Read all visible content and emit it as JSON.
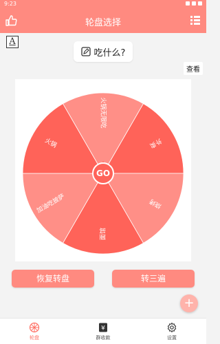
{
  "status_bar": {
    "time": "9:23"
  },
  "app_bar": {
    "title": "轮盘选择"
  },
  "font_toggle": {
    "label": "A"
  },
  "topic": {
    "label": "吃什么?"
  },
  "view_button": {
    "label": "查看"
  },
  "wheel": {
    "center_label": "GO",
    "segments": [
      {
        "label": "火锅无限吃",
        "color": "#ff8f87"
      },
      {
        "label": "外卖",
        "color": "#ff6359"
      },
      {
        "label": "烧烤",
        "color": "#ff8f87"
      },
      {
        "label": "面馆",
        "color": "#ff6359"
      },
      {
        "label": "加油吃披萨",
        "color": "#ff8f87"
      },
      {
        "label": "火锅",
        "color": "#ff6359"
      }
    ]
  },
  "buttons": {
    "reset": "恢复转盘",
    "spin_three": "转三遍"
  },
  "fab": {
    "label": "+"
  },
  "bottom_nav": [
    {
      "label": "轮盘",
      "active": true,
      "icon": "wheel-icon"
    },
    {
      "label": "群收款",
      "active": false,
      "icon": "yen-icon"
    },
    {
      "label": "设置",
      "active": false,
      "icon": "gear-icon"
    }
  ],
  "colors": {
    "accent": "#ff8a80",
    "segment_light": "#ff8f87",
    "segment_dark": "#ff6359"
  }
}
